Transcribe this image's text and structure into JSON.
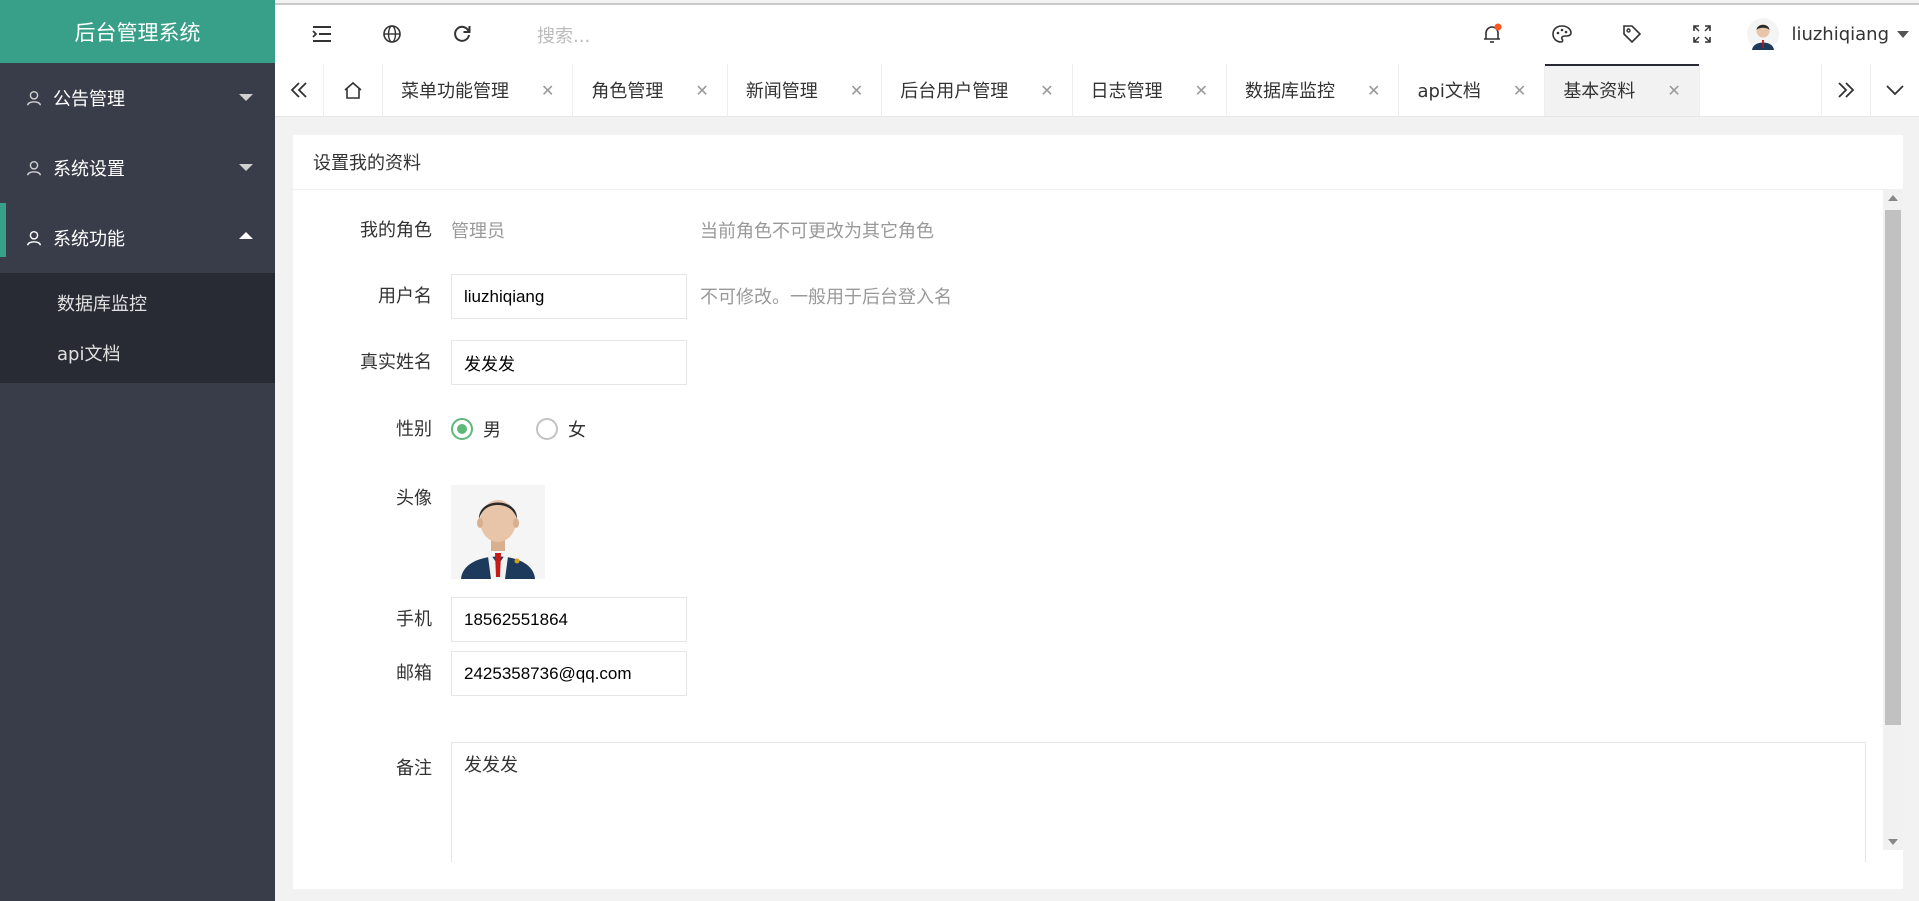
{
  "app": {
    "title": "后台管理系统"
  },
  "sidebar": {
    "items": [
      {
        "label": "公告管理",
        "expanded": false
      },
      {
        "label": "系统设置",
        "expanded": false
      },
      {
        "label": "系统功能",
        "expanded": true
      }
    ],
    "submenu": [
      {
        "label": "数据库监控"
      },
      {
        "label": "api文档"
      }
    ]
  },
  "topbar": {
    "search_placeholder": "搜索...",
    "icons": [
      "menu-fold-icon",
      "globe-icon",
      "refresh-icon",
      "bell-icon",
      "palette-icon",
      "tag-icon",
      "fullscreen-icon"
    ],
    "username": "liuzhiqiang"
  },
  "tabs": [
    {
      "label": "菜单功能管理"
    },
    {
      "label": "角色管理"
    },
    {
      "label": "新闻管理"
    },
    {
      "label": "后台用户管理"
    },
    {
      "label": "日志管理"
    },
    {
      "label": "数据库监控"
    },
    {
      "label": "api文档"
    },
    {
      "label": "基本资料",
      "active": true
    }
  ],
  "form": {
    "title": "设置我的资料",
    "role": {
      "label": "我的角色",
      "value": "管理员",
      "hint": "当前角色不可更改为其它角色"
    },
    "username": {
      "label": "用户名",
      "value": "liuzhiqiang",
      "hint": "不可修改。一般用于后台登入名"
    },
    "realname": {
      "label": "真实姓名",
      "value": "发发发"
    },
    "gender": {
      "label": "性别",
      "options": [
        "男",
        "女"
      ],
      "selected": "男"
    },
    "avatar": {
      "label": "头像"
    },
    "phone": {
      "label": "手机",
      "value": "18562551864"
    },
    "email": {
      "label": "邮箱",
      "value": "2425358736@qq.com"
    },
    "remark": {
      "label": "备注",
      "value": "发发发"
    }
  },
  "colors": {
    "brand": "#389f88",
    "sidebar_bg": "#393d49",
    "submenu_bg": "#282b33",
    "radio": "#5fb878",
    "notify_dot": "#ff5722"
  }
}
